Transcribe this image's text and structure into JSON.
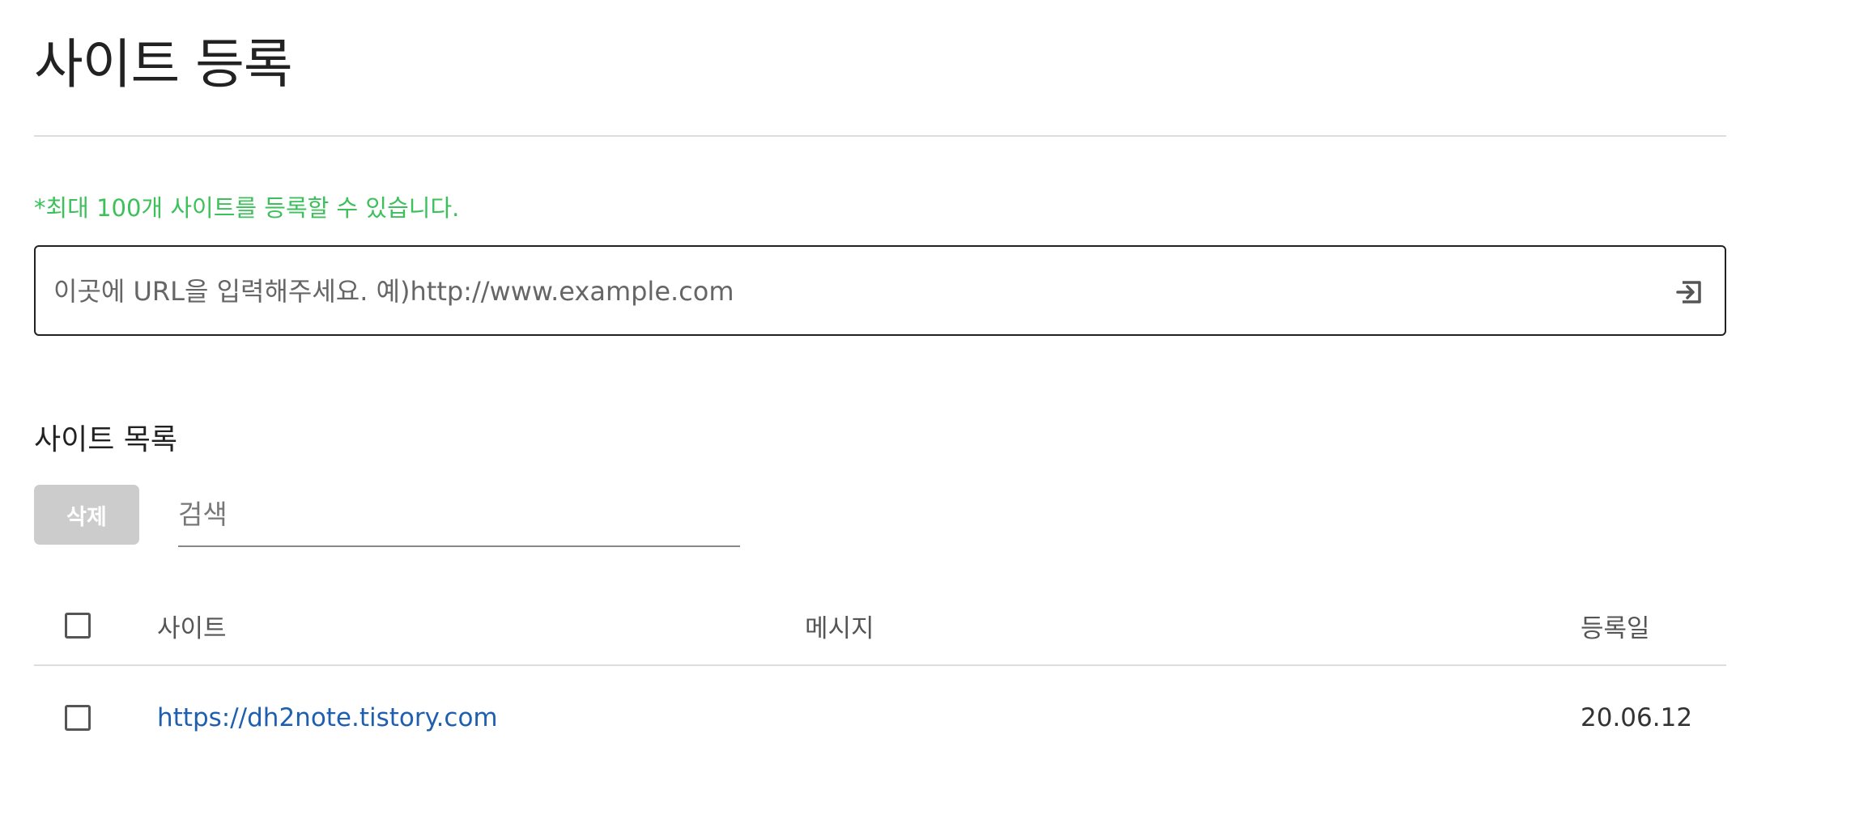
{
  "page": {
    "title": "사이트 등록"
  },
  "register": {
    "notice": "*최대 100개 사이트를 등록할 수 있습니다.",
    "url_placeholder": "이곳에 URL을 입력해주세요. 예)http://www.example.com",
    "url_value": "",
    "submit_icon": "enter-arrow-icon"
  },
  "site_list": {
    "title": "사이트 목록",
    "delete_label": "삭제",
    "search_placeholder": "검색",
    "search_value": "",
    "columns": {
      "site": "사이트",
      "message": "메시지",
      "date": "등록일"
    },
    "rows": [
      {
        "site": "https://dh2note.tistory.com",
        "message": "",
        "date": "20.06.12",
        "checked": false
      }
    ]
  },
  "colors": {
    "notice_green": "#3cc15a",
    "link_blue": "#1f5fb0",
    "disabled_button": "#cccccc"
  }
}
